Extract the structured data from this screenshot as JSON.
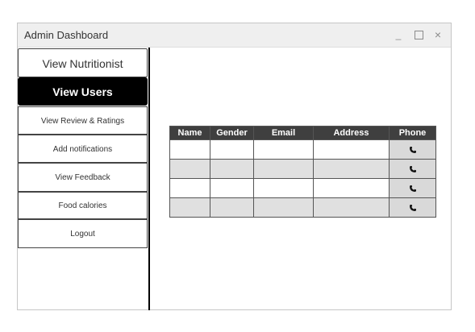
{
  "window": {
    "title": "Admin Dashboard",
    "controls": {
      "minimize": "_",
      "close": "×"
    }
  },
  "sidebar": {
    "items": [
      {
        "label": "View Nutritionist",
        "active": false
      },
      {
        "label": "View Users",
        "active": true
      },
      {
        "label": "View Review & Ratings",
        "active": false
      },
      {
        "label": "Add notifications",
        "active": false
      },
      {
        "label": "View Feedback",
        "active": false
      },
      {
        "label": "Food calories",
        "active": false
      },
      {
        "label": "Logout",
        "active": false
      }
    ]
  },
  "table": {
    "headers": [
      "Name",
      "Gender",
      "Email",
      "Address",
      "Phone"
    ],
    "rows": [
      {
        "name": "",
        "gender": "",
        "email": "",
        "address": "",
        "phone_icon": "phone-icon"
      },
      {
        "name": "",
        "gender": "",
        "email": "",
        "address": "",
        "phone_icon": "phone-icon"
      },
      {
        "name": "",
        "gender": "",
        "email": "",
        "address": "",
        "phone_icon": "phone-icon"
      },
      {
        "name": "",
        "gender": "",
        "email": "",
        "address": "",
        "phone_icon": "phone-icon"
      }
    ]
  },
  "colors": {
    "active_nav_bg": "#000000",
    "table_header_bg": "#3f3f3f",
    "row_alt_bg": "#e0e0e0"
  }
}
